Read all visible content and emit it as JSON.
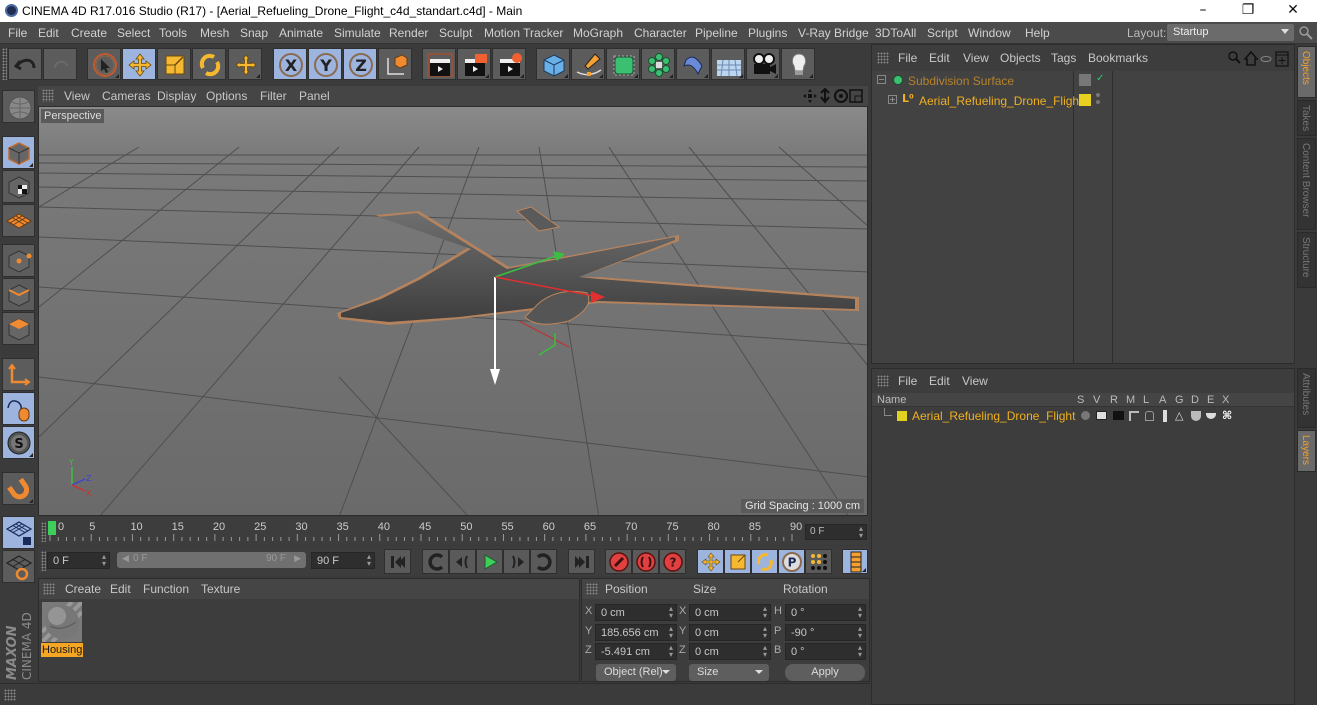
{
  "window": {
    "title": "CINEMA 4D R17.016 Studio (R17) - [Aerial_Refueling_Drone_Flight_c4d_standart.c4d] - Main",
    "minimize": "–",
    "restore": "❐",
    "close": "✕"
  },
  "menubar": {
    "items": [
      "File",
      "Edit",
      "Create",
      "Select",
      "Tools",
      "Mesh",
      "Snap",
      "Animate",
      "Simulate",
      "Render",
      "Sculpt",
      "Motion Tracker",
      "MoGraph",
      "Character",
      "Pipeline",
      "Plugins",
      "V-Ray Bridge",
      "3DToAll",
      "Script",
      "Window",
      "Help"
    ],
    "layout_label": "Layout:",
    "layout_value": "Startup"
  },
  "toolbar": {
    "icons": [
      "undo-icon",
      "redo-icon",
      "live-selection-icon",
      "move-icon",
      "scale-icon",
      "rotate-icon",
      "last-tool-icon",
      "x-axis-lock-icon",
      "y-axis-lock-icon",
      "z-axis-lock-icon",
      "coordinate-system-icon",
      "render-view-icon",
      "render-picture-viewer-icon",
      "render-settings-icon",
      "cube-icon",
      "pen-spline-icon",
      "subdivision-surface-icon",
      "cloner-icon",
      "deformer-icon",
      "floor-icon",
      "camera-icon",
      "light-icon"
    ]
  },
  "left_toolbar": {
    "icons": [
      "make-editable-icon",
      "model-mode-icon",
      "texture-mode-icon",
      "workplane-mode-icon",
      "points-mode-icon",
      "edges-mode-icon",
      "polygons-mode-icon",
      "axis-mode-icon",
      "tweak-mode-icon",
      "solo-mode-icon",
      "snap-magnet-icon",
      "lock-workplane-icon",
      "workplane-rotate-icon"
    ]
  },
  "viewport": {
    "menu": [
      "View",
      "Cameras",
      "Display",
      "Options",
      "Filter",
      "Panel"
    ],
    "camera_label": "Perspective",
    "grid_spacing": "Grid Spacing : 1000 cm",
    "axis_labels": {
      "y": "Y",
      "z": "Z",
      "x": "X"
    }
  },
  "timeline": {
    "ticks": [
      "0",
      "5",
      "10",
      "15",
      "20",
      "25",
      "30",
      "35",
      "40",
      "45",
      "50",
      "55",
      "60",
      "65",
      "70",
      "75",
      "80",
      "85",
      "90"
    ],
    "current_frame": "0 F",
    "min": 0,
    "max": 90
  },
  "playback": {
    "start_field": "0 F",
    "range_start": "0 F",
    "range_end": "90 F",
    "end_field": "90 F"
  },
  "material_panel": {
    "menu": [
      "Create",
      "Edit",
      "Function",
      "Texture"
    ],
    "materials": [
      {
        "name": "Housing"
      }
    ]
  },
  "coordinates": {
    "headers": {
      "position": "Position",
      "size": "Size",
      "rotation": "Rotation"
    },
    "position": [
      {
        "axis": "X",
        "value": "0 cm"
      },
      {
        "axis": "Y",
        "value": "185.656 cm"
      },
      {
        "axis": "Z",
        "value": "-5.491 cm"
      }
    ],
    "size": [
      {
        "axis": "X",
        "value": "0 cm"
      },
      {
        "axis": "Y",
        "value": "0 cm"
      },
      {
        "axis": "Z",
        "value": "0 cm"
      }
    ],
    "rotation": [
      {
        "axis": "H",
        "value": "0 °"
      },
      {
        "axis": "P",
        "value": "-90 °"
      },
      {
        "axis": "B",
        "value": "0 °"
      }
    ],
    "mode_dropdown": "Object (Rel)",
    "size_dropdown": "Size",
    "apply_label": "Apply"
  },
  "object_manager": {
    "menu": [
      "File",
      "Edit",
      "View",
      "Objects",
      "Tags",
      "Bookmarks"
    ],
    "objects": [
      {
        "name": "Subdivision Surface",
        "color": "#b5832c"
      },
      {
        "name": "Aerial_Refueling_Drone_Flight",
        "color": "#f0b020"
      }
    ]
  },
  "layer_manager": {
    "menu": [
      "File",
      "Edit",
      "View"
    ],
    "columns": [
      "Name",
      "S",
      "V",
      "R",
      "M",
      "L",
      "A",
      "G",
      "D",
      "E",
      "X"
    ],
    "layers": [
      {
        "name": "Aerial_Refueling_Drone_Flight",
        "color": "#e0d020"
      }
    ]
  },
  "side_tabs": {
    "top": [
      "Objects",
      "Takes",
      "Content Browser",
      "Structure"
    ],
    "bottom": [
      "Attributes",
      "Layers"
    ]
  },
  "brand": {
    "maker": "MAXON",
    "product": "CINEMA 4D"
  },
  "colors": {
    "accent_selected": "#9cb4de",
    "object_name": "#f0b020",
    "active_tab_text": "#f0a030",
    "timeline_marker": "#3ecf5a"
  }
}
